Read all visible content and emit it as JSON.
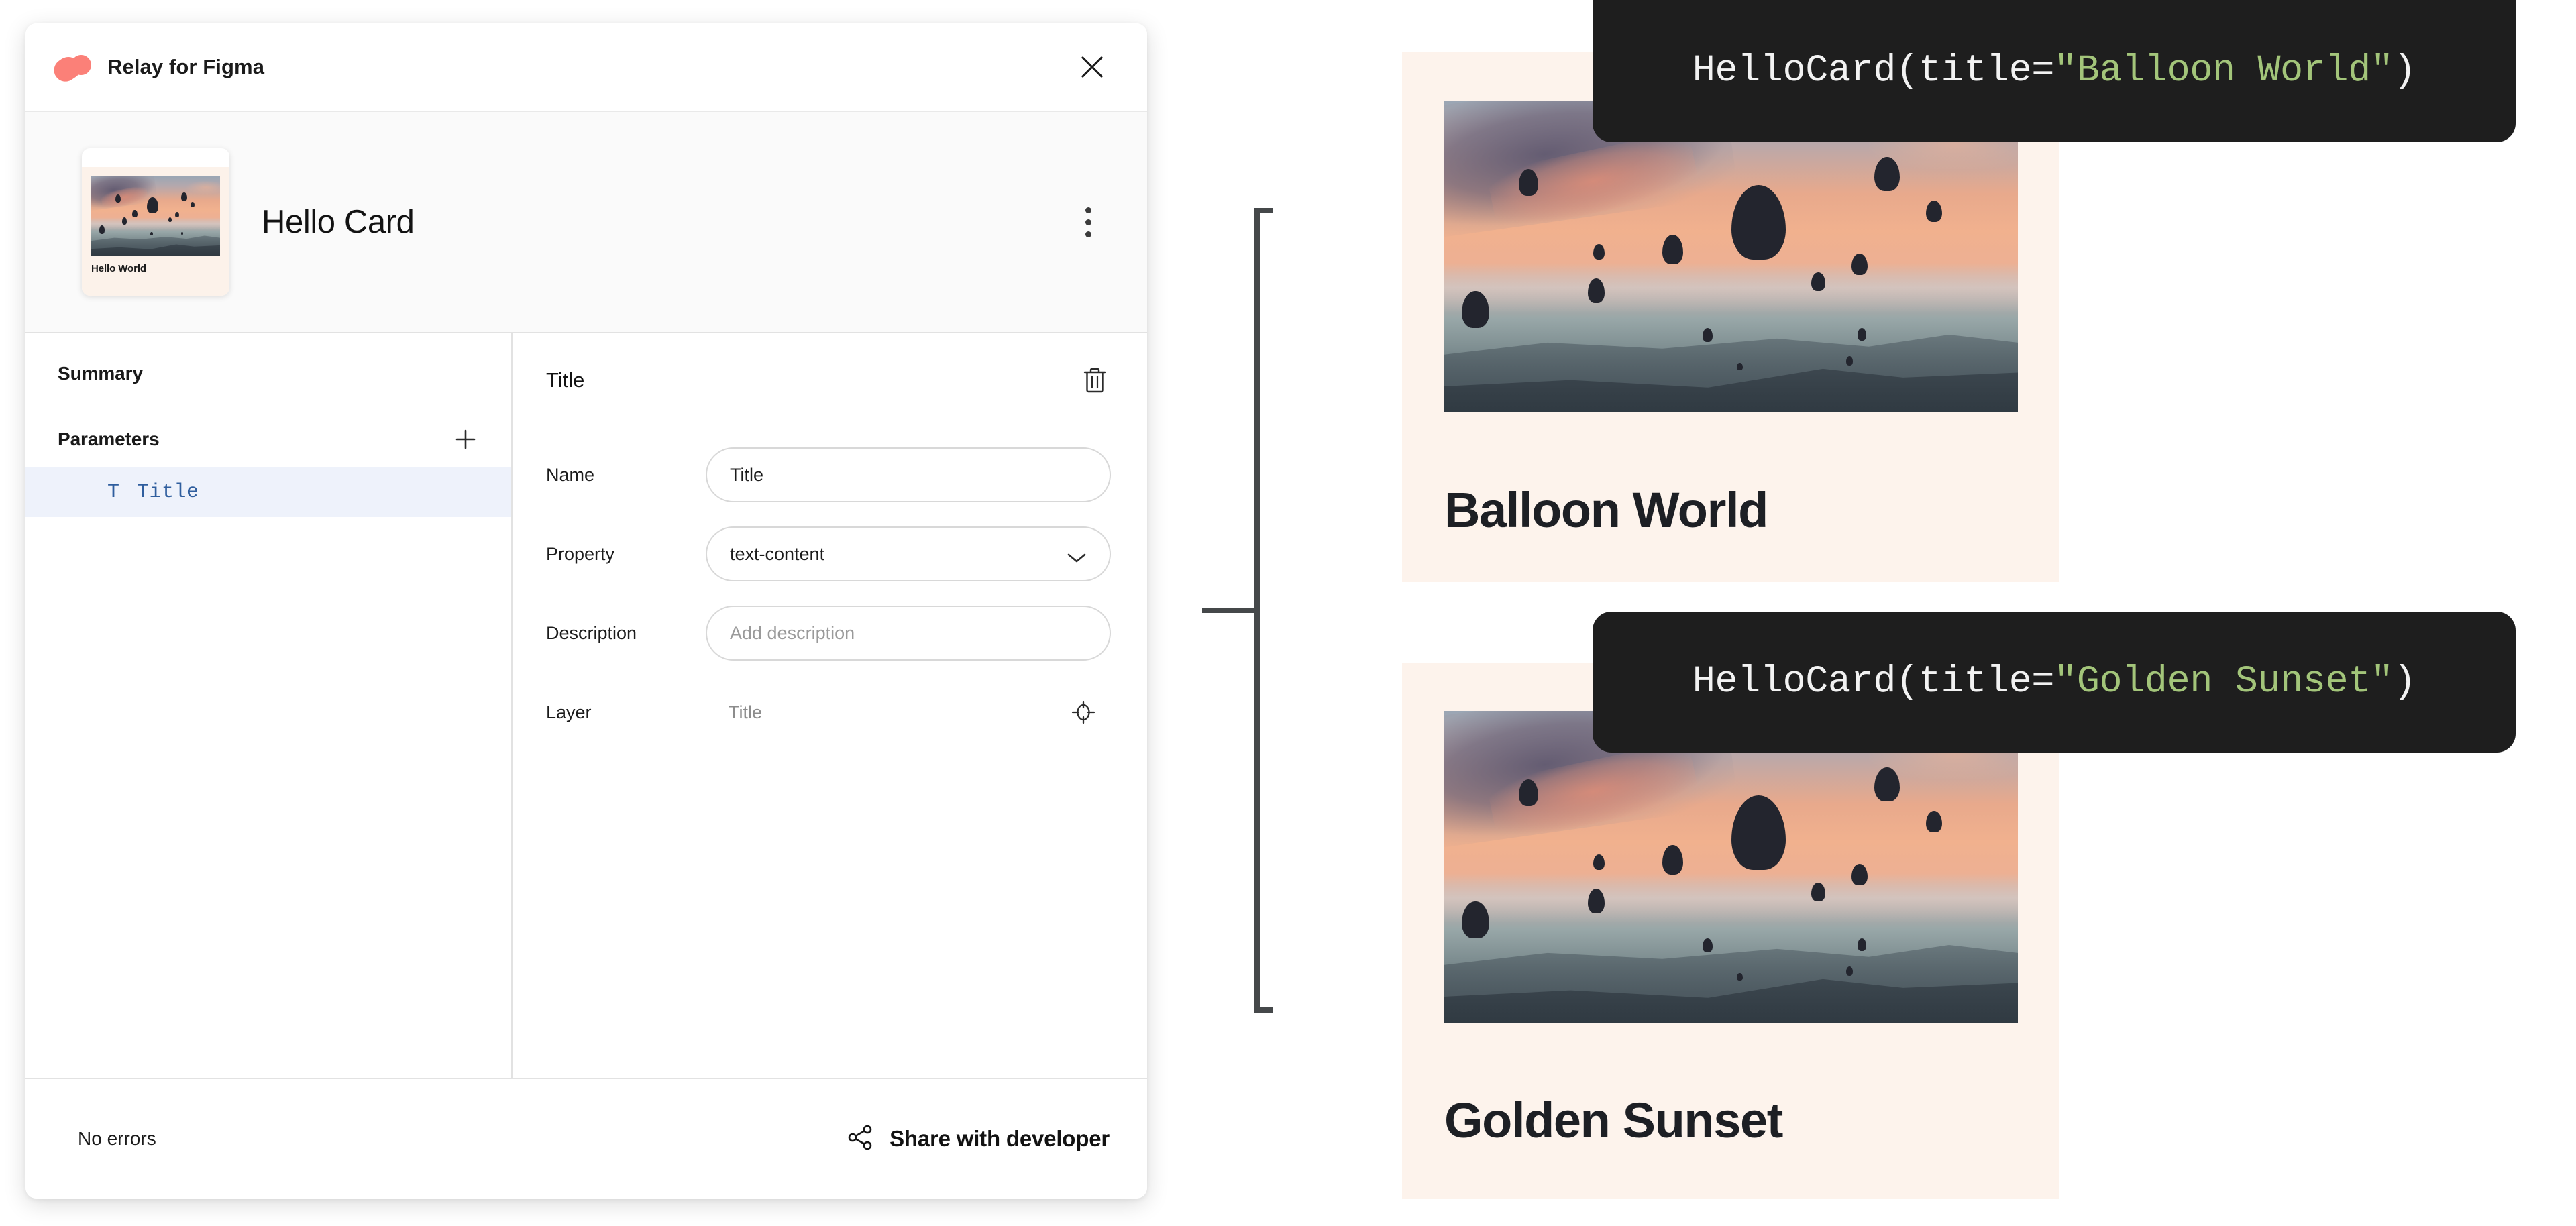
{
  "plugin": {
    "titlebar": {
      "logo_icon": "relay-logo-icon",
      "title": "Relay for Figma",
      "close_icon": "close-icon"
    },
    "component": {
      "thumbnail_caption": "Hello World",
      "name": "Hello Card",
      "menu_icon": "kebab-menu-icon"
    },
    "left_panel": {
      "summary_heading": "Summary",
      "parameters_heading": "Parameters",
      "add_parameter_icon": "plus-icon",
      "parameters": [
        {
          "type_icon": "text-type-icon",
          "type_glyph": "T",
          "name": "Title",
          "selected": true
        }
      ]
    },
    "detail_panel": {
      "title": "Title",
      "delete_icon": "trash-icon",
      "fields": [
        {
          "label": "Name",
          "value": "Title",
          "placeholder": "",
          "control": "text"
        },
        {
          "label": "Property",
          "value": "text-content",
          "placeholder": "",
          "control": "select",
          "icon": "chevron-down-icon"
        },
        {
          "label": "Description",
          "value": "",
          "placeholder": "Add description",
          "control": "text"
        },
        {
          "label": "Layer",
          "value": "Title",
          "placeholder": "",
          "control": "plain",
          "icon": "target-icon"
        }
      ]
    },
    "footer": {
      "status": "No errors",
      "share_icon": "share-nodes-icon",
      "share_label": "Share with developer"
    }
  },
  "canvas": {
    "bracket_icon": "brace-connector",
    "previews": [
      {
        "card_title": "Balloon World",
        "image_alt": "hot-air-balloons-at-sunset",
        "tooltip": {
          "prefix": "HelloCard(title=",
          "string": "\"Balloon World\"",
          "suffix": ")"
        }
      },
      {
        "card_title": "Golden Sunset",
        "image_alt": "hot-air-balloons-at-sunset",
        "tooltip": {
          "prefix": "HelloCard(title=",
          "string": "\"Golden Sunset\"",
          "suffix": ")"
        }
      }
    ]
  },
  "colors": {
    "brand_coral": "#fb8078",
    "selected_row_bg": "#eef2fb",
    "selected_row_text": "#2f5e9e",
    "card_bg": "#fdf3ec",
    "tooltip_bg": "#1e1e1e",
    "tooltip_string": "#a3c57a",
    "tooltip_text": "#f2f2f2"
  }
}
